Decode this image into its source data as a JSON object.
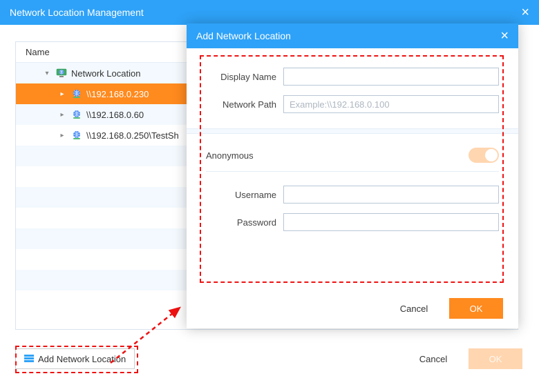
{
  "main": {
    "title": "Network Location Management",
    "tree_header": "Name",
    "root_label": "Network Location",
    "nodes": [
      {
        "label": "\\\\192.168.0.230",
        "selected": true
      },
      {
        "label": "\\\\192.168.0.60",
        "selected": false
      },
      {
        "label": "\\\\192.168.0.250\\TestSh",
        "selected": false
      }
    ],
    "add_button": "Add Network Location",
    "cancel": "Cancel",
    "ok": "OK"
  },
  "modal": {
    "title": "Add Network Location",
    "display_name_label": "Display Name",
    "display_name_value": "",
    "network_path_label": "Network Path",
    "network_path_placeholder": "Example:\\\\192.168.0.100",
    "network_path_value": "",
    "anonymous_label": "Anonymous",
    "anonymous_on": true,
    "username_label": "Username",
    "username_value": "",
    "password_label": "Password",
    "password_value": "",
    "cancel": "Cancel",
    "ok": "OK"
  }
}
